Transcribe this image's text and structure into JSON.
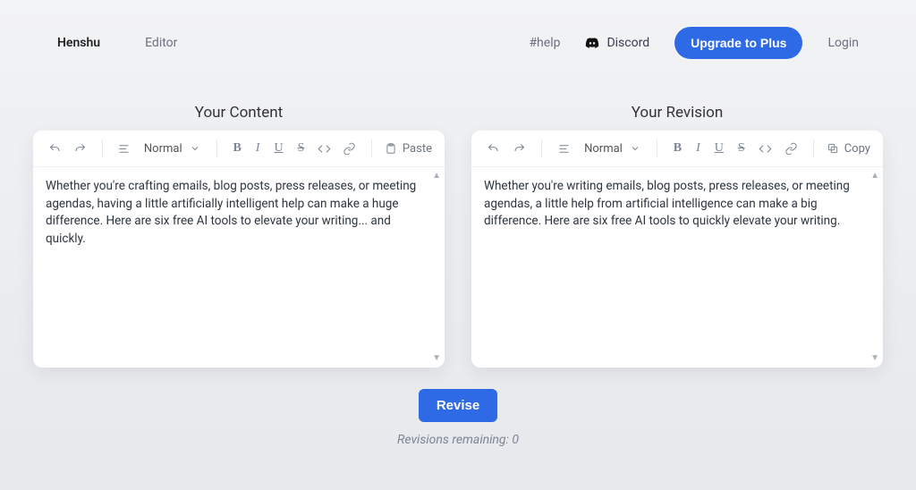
{
  "nav": {
    "brand": "Henshu",
    "editor_link": "Editor",
    "help_link": "#help",
    "discord_label": "Discord",
    "upgrade_label": "Upgrade to Plus",
    "login_label": "Login"
  },
  "panels": {
    "left": {
      "title": "Your Content",
      "format_label": "Normal",
      "action_label": "Paste",
      "text": "Whether you're crafting emails, blog posts, press releases, or meeting agendas, having a little artificially intelligent help can make a huge difference. Here are six free AI tools to elevate your writing... and quickly."
    },
    "right": {
      "title": "Your Revision",
      "format_label": "Normal",
      "action_label": "Copy",
      "text": "Whether you're writing emails, blog posts, press releases, or meeting agendas, a little help from artificial intelligence can make a big difference. Here are six free AI tools to quickly elevate your writing."
    }
  },
  "toolbar_letters": {
    "bold": "B",
    "italic": "I",
    "underline": "U",
    "strike": "S"
  },
  "actions": {
    "revise_label": "Revise",
    "remaining_text": "Revisions remaining: 0"
  }
}
